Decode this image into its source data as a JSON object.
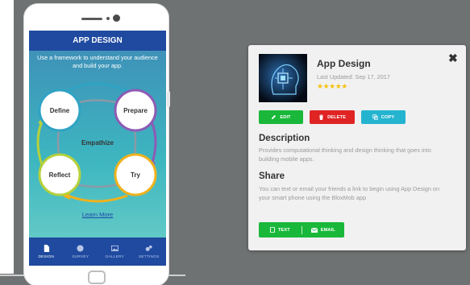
{
  "phone_screen": {
    "header_title": "APP DESIGN",
    "subtitle": "Use a framework to understand your audience and build your app.",
    "cycle": {
      "center": "Empathize",
      "stages": [
        "Define",
        "Prepare",
        "Try",
        "Reflect"
      ],
      "colors": {
        "define": "#2fa3c4",
        "prepare": "#8d5bb5",
        "try": "#f0b21c",
        "reflect": "#b5d13b"
      }
    },
    "learn_more": "Learn More",
    "tabs": [
      {
        "label": "DESIGN",
        "icon": "document-icon",
        "active": true
      },
      {
        "label": "SURVEY",
        "icon": "globe-icon",
        "active": false
      },
      {
        "label": "GALLERY",
        "icon": "image-icon",
        "active": false
      },
      {
        "label": "SETTINGS",
        "icon": "cogs-icon",
        "active": false
      }
    ]
  },
  "card": {
    "title": "App Design",
    "updated": "Last Updated: Sep 17, 2017",
    "rating": "★★★★★",
    "close": "✖",
    "actions": {
      "edit": "EDIT",
      "delete": "DELETE",
      "copy": "COPY"
    },
    "description": {
      "heading": "Description",
      "text": "Provides computational thinking and design thinking that goes into building mobile apps."
    },
    "share": {
      "heading": "Share",
      "text": "You can text or email your friends a link to begin using App Design on your smart phone using the BloxMob app",
      "text_label": "TEXT",
      "email_label": "EMAIL"
    }
  },
  "colors": {
    "green": "#19b83a",
    "red": "#e02424",
    "cyan": "#25b4cf",
    "navy": "#1f4aa0",
    "star": "#f4c20d"
  }
}
